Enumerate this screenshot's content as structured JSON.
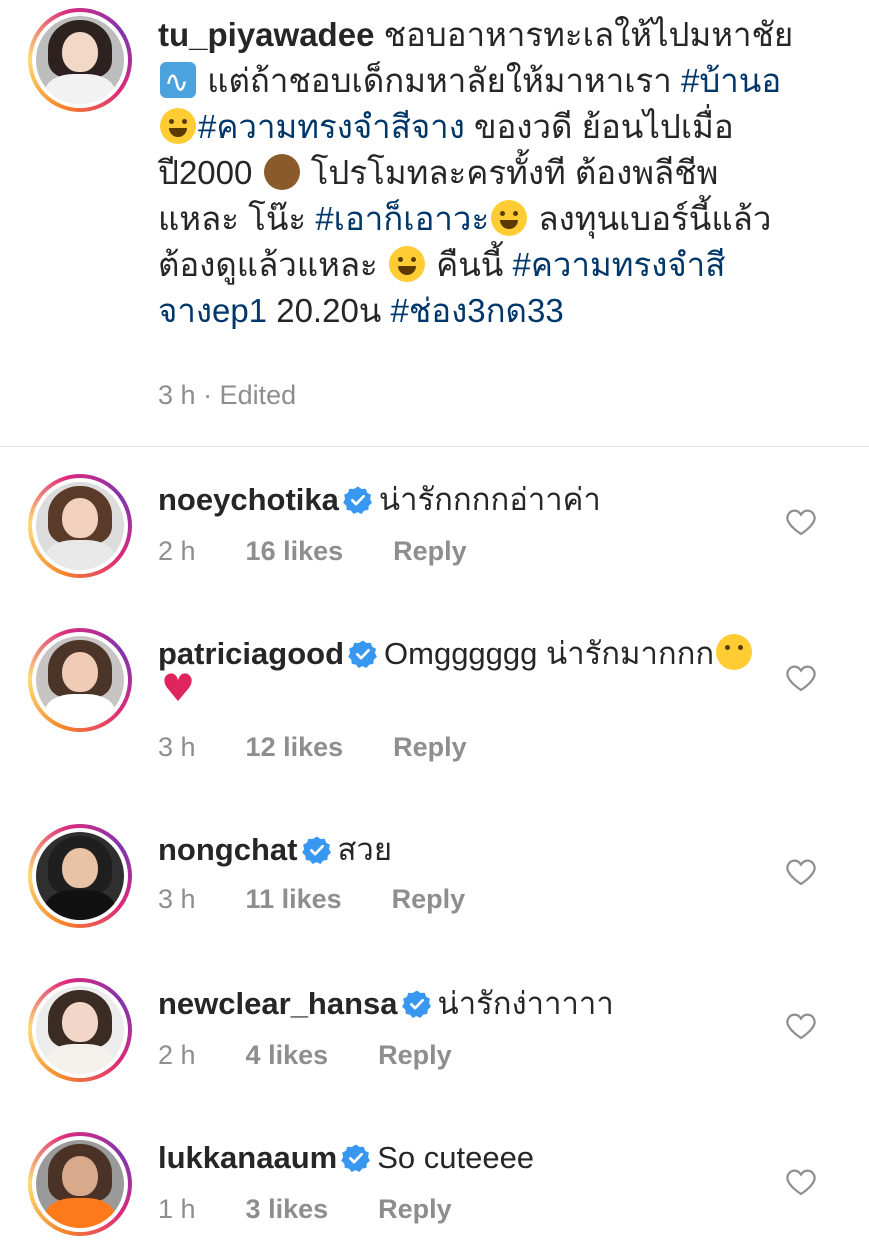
{
  "post": {
    "username": "tu_piyawadee",
    "caption_parts": [
      {
        "type": "text",
        "text": " ชอบอาหารทะเลให้ไปมหาชัย "
      },
      {
        "type": "emoji",
        "icon": "wave"
      },
      {
        "type": "text",
        "text": " แต่ถ้าชอบเด็กมหาลัยให้มาหาเรา "
      },
      {
        "type": "tag",
        "text": "#บ้านอ"
      },
      {
        "type": "emoji",
        "icon": "face"
      },
      {
        "type": "tag",
        "text": "#ความทรงจำสีจาง"
      },
      {
        "type": "text",
        "text": " ของวดี ย้อนไปเมื่อปี2000 "
      },
      {
        "type": "emoji",
        "icon": "monkey"
      },
      {
        "type": "text",
        "text": " โปรโมทละครทั้งที ต้องพลีชีพแหละ โน๊ะ "
      },
      {
        "type": "tag",
        "text": "#เอาก็เอาวะ"
      },
      {
        "type": "emoji",
        "icon": "face"
      },
      {
        "type": "text",
        "text": " ลงทุนเบอร์นี้แล้ว ต้องดูแล้วแหละ "
      },
      {
        "type": "emoji",
        "icon": "face"
      },
      {
        "type": "text",
        "text": " คืนนี้ "
      },
      {
        "type": "tag",
        "text": "#ความทรงจำสีจางep1"
      },
      {
        "type": "text",
        "text": " 20.20น "
      },
      {
        "type": "tag",
        "text": "#ช่อง3กด33"
      }
    ],
    "time": "3 h",
    "edited": "· Edited"
  },
  "comments": [
    {
      "username": "noeychotika",
      "text": "น่ารักกกกอ่าาค่า",
      "emojis": [],
      "time": "2 h",
      "likes": "16 likes",
      "reply": "Reply",
      "skin": "#f2d2bf",
      "hair": "#5a3b2a",
      "bg": "#dcdcdc",
      "outfit": "#e8e8e8"
    },
    {
      "username": "patriciagood",
      "text": "Omgggggg น่ารักมากกก",
      "emojis": [
        "pleading",
        "heart"
      ],
      "time": "3 h",
      "likes": "12 likes",
      "reply": "Reply",
      "skin": "#f0cbb5",
      "hair": "#4b3428",
      "bg": "#c9c4c4",
      "outfit": "#ffffff"
    },
    {
      "username": "nongchat",
      "text": "สวย",
      "emojis": [],
      "time": "3 h",
      "likes": "11 likes",
      "reply": "Reply",
      "skin": "#e9c3a6",
      "hair": "#1f1f1f",
      "bg": "#2f2f2f",
      "outfit": "#111111"
    },
    {
      "username": "newclear_hansa",
      "text": "น่ารักง่าาาาา",
      "emojis": [],
      "time": "2 h",
      "likes": "4 likes",
      "reply": "Reply",
      "skin": "#f2d6c8",
      "hair": "#3a2c22",
      "bg": "#ececec",
      "outfit": "#f4f0ec"
    },
    {
      "username": "lukkanaaum",
      "text": "So cuteeee",
      "emojis": [],
      "time": "1 h",
      "likes": "3 likes",
      "reply": "Reply",
      "skin": "#d8a98a",
      "hair": "#4a3326",
      "bg": "#9a9a9a",
      "outfit": "#ff7a1a"
    }
  ],
  "colors": {
    "text": "#262626",
    "hashtag": "#00376b",
    "muted": "#8e8e8e",
    "verified": "#3897f0"
  },
  "icons": {
    "verified": "verified-badge-icon",
    "like": "heart-outline-icon"
  },
  "main_avatar": {
    "skin": "#f3d8c8",
    "hair": "#2e2220",
    "bg": "#bdbdbd",
    "outfit": "#f2f2f2"
  }
}
